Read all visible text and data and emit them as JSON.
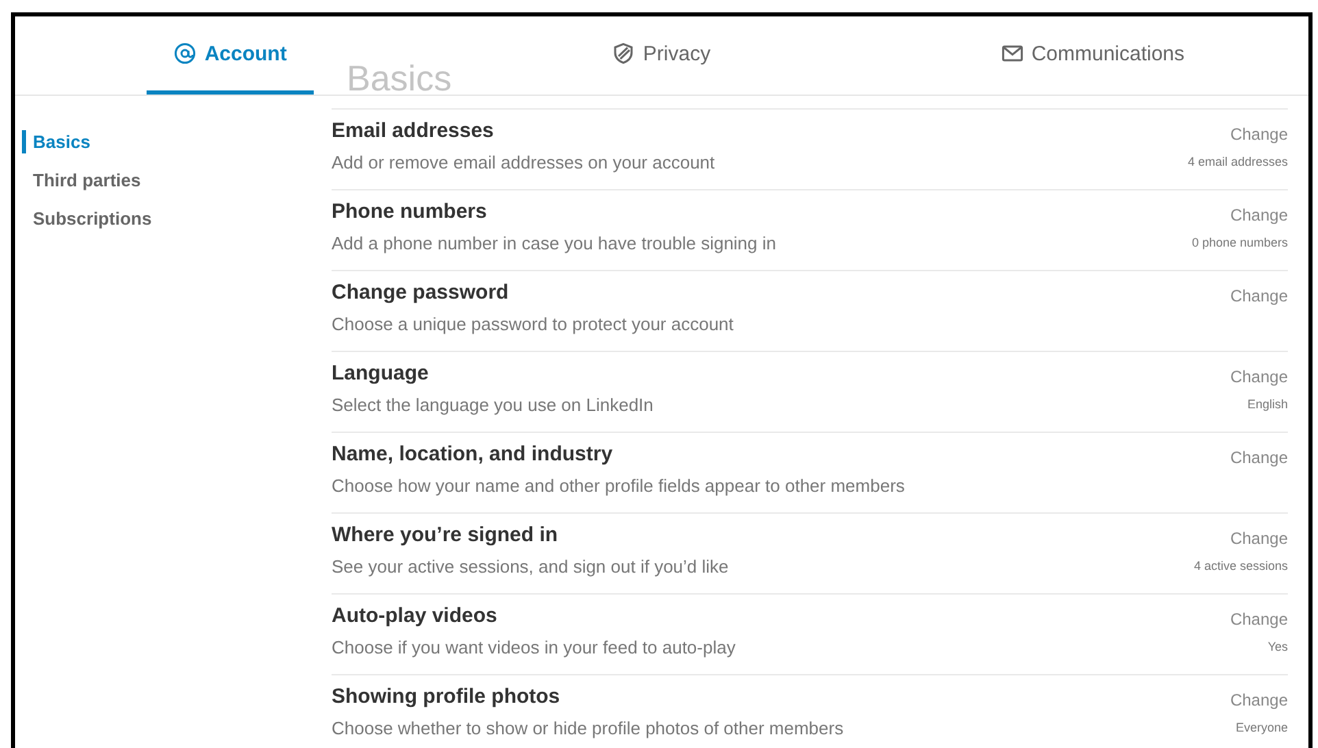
{
  "tabs": [
    {
      "label": "Account",
      "selected": true
    },
    {
      "label": "Privacy",
      "selected": false
    },
    {
      "label": "Communications",
      "selected": false
    }
  ],
  "section_heading": "Basics",
  "sidebar": {
    "items": [
      {
        "label": "Basics",
        "selected": true
      },
      {
        "label": "Third parties",
        "selected": false
      },
      {
        "label": "Subscriptions",
        "selected": false
      }
    ]
  },
  "settings": [
    {
      "title": "Email addresses",
      "description": "Add or remove email addresses on your account",
      "action": "Change",
      "value": "4 email addresses"
    },
    {
      "title": "Phone numbers",
      "description": "Add a phone number in case you have trouble signing in",
      "action": "Change",
      "value": "0 phone numbers"
    },
    {
      "title": "Change password",
      "description": "Choose a unique password to protect your account",
      "action": "Change"
    },
    {
      "title": "Language",
      "description": "Select the language you use on LinkedIn",
      "action": "Change",
      "value": "English"
    },
    {
      "title": "Name, location, and industry",
      "description": "Choose how your name and other profile fields appear to other members",
      "action": "Change"
    },
    {
      "title": "Where you’re signed in",
      "description": "See your active sessions, and sign out if you’d like",
      "action": "Change",
      "value": "4 active sessions"
    },
    {
      "title": "Auto-play videos",
      "description": "Choose if you want videos in your feed to auto-play",
      "action": "Change",
      "value": "Yes"
    },
    {
      "title": "Showing profile photos",
      "description": "Choose whether to show or hide profile photos of other members",
      "action": "Change",
      "value": "Everyone"
    }
  ]
}
